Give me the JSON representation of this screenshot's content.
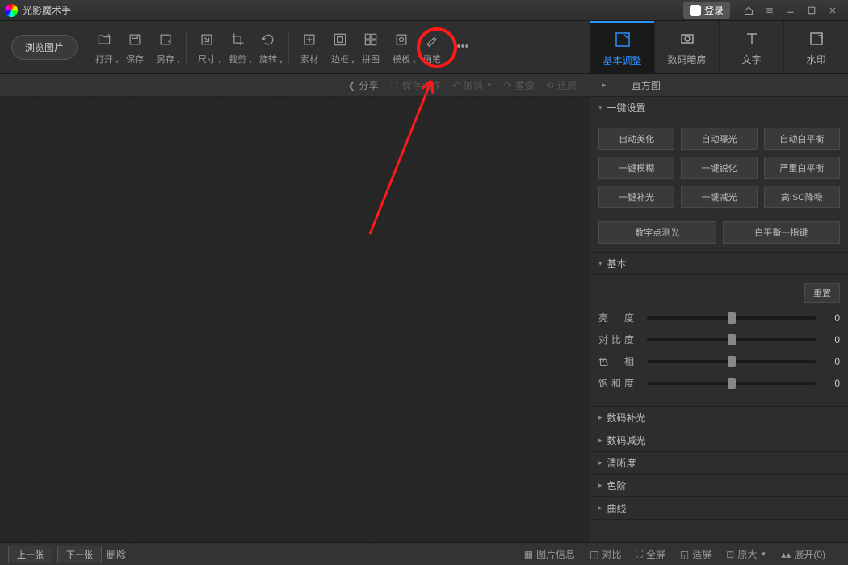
{
  "app": {
    "title": "光影魔术手",
    "login": "登录"
  },
  "toolbar": {
    "browse": "浏览图片",
    "tools": [
      {
        "id": "open",
        "label": "打开",
        "dd": true
      },
      {
        "id": "save",
        "label": "保存",
        "dd": false
      },
      {
        "id": "saveas",
        "label": "另存",
        "dd": true
      },
      {
        "id": "size",
        "label": "尺寸",
        "dd": true
      },
      {
        "id": "crop",
        "label": "裁剪",
        "dd": true
      },
      {
        "id": "rotate",
        "label": "旋转",
        "dd": true
      },
      {
        "id": "material",
        "label": "素材",
        "dd": false
      },
      {
        "id": "border",
        "label": "边框",
        "dd": true
      },
      {
        "id": "puzzle",
        "label": "拼图",
        "dd": false
      },
      {
        "id": "template",
        "label": "模板",
        "dd": true
      },
      {
        "id": "brush",
        "label": "画笔",
        "dd": false
      },
      {
        "id": "more",
        "label": "",
        "dd": false
      }
    ],
    "tabs": [
      {
        "id": "basic",
        "label": "基本调整",
        "active": true
      },
      {
        "id": "darkroom",
        "label": "数码暗房",
        "active": false
      },
      {
        "id": "text",
        "label": "文字",
        "active": false
      },
      {
        "id": "watermark",
        "label": "水印",
        "active": false
      }
    ]
  },
  "subbar": {
    "share": "分享",
    "save_action": "保存动作",
    "undo": "撤销",
    "redo": "重做",
    "restore": "还原"
  },
  "panel": {
    "histogram": "直方图",
    "oneclick": {
      "title": "一键设置",
      "buttons": [
        "自动美化",
        "自动曝光",
        "自动白平衡",
        "一键模糊",
        "一键锐化",
        "严重白平衡",
        "一键补光",
        "一键减光",
        "高ISO降噪"
      ],
      "extra": [
        "数字点测光",
        "白平衡一指键"
      ]
    },
    "basic": {
      "title": "基本",
      "reset": "重置",
      "sliders": [
        {
          "label": "亮　度",
          "value": 0
        },
        {
          "label": "对比度",
          "value": 0
        },
        {
          "label": "色　相",
          "value": 0
        },
        {
          "label": "饱和度",
          "value": 0
        }
      ]
    },
    "collapsed": [
      "数码补光",
      "数码减光",
      "清晰度",
      "色阶",
      "曲线"
    ]
  },
  "statusbar": {
    "prev": "上一张",
    "next": "下一张",
    "delete": "删除",
    "info": "图片信息",
    "compare": "对比",
    "fullscreen": "全屏",
    "fitscreen": "适屏",
    "original": "原大",
    "expand": "展开(0)"
  }
}
